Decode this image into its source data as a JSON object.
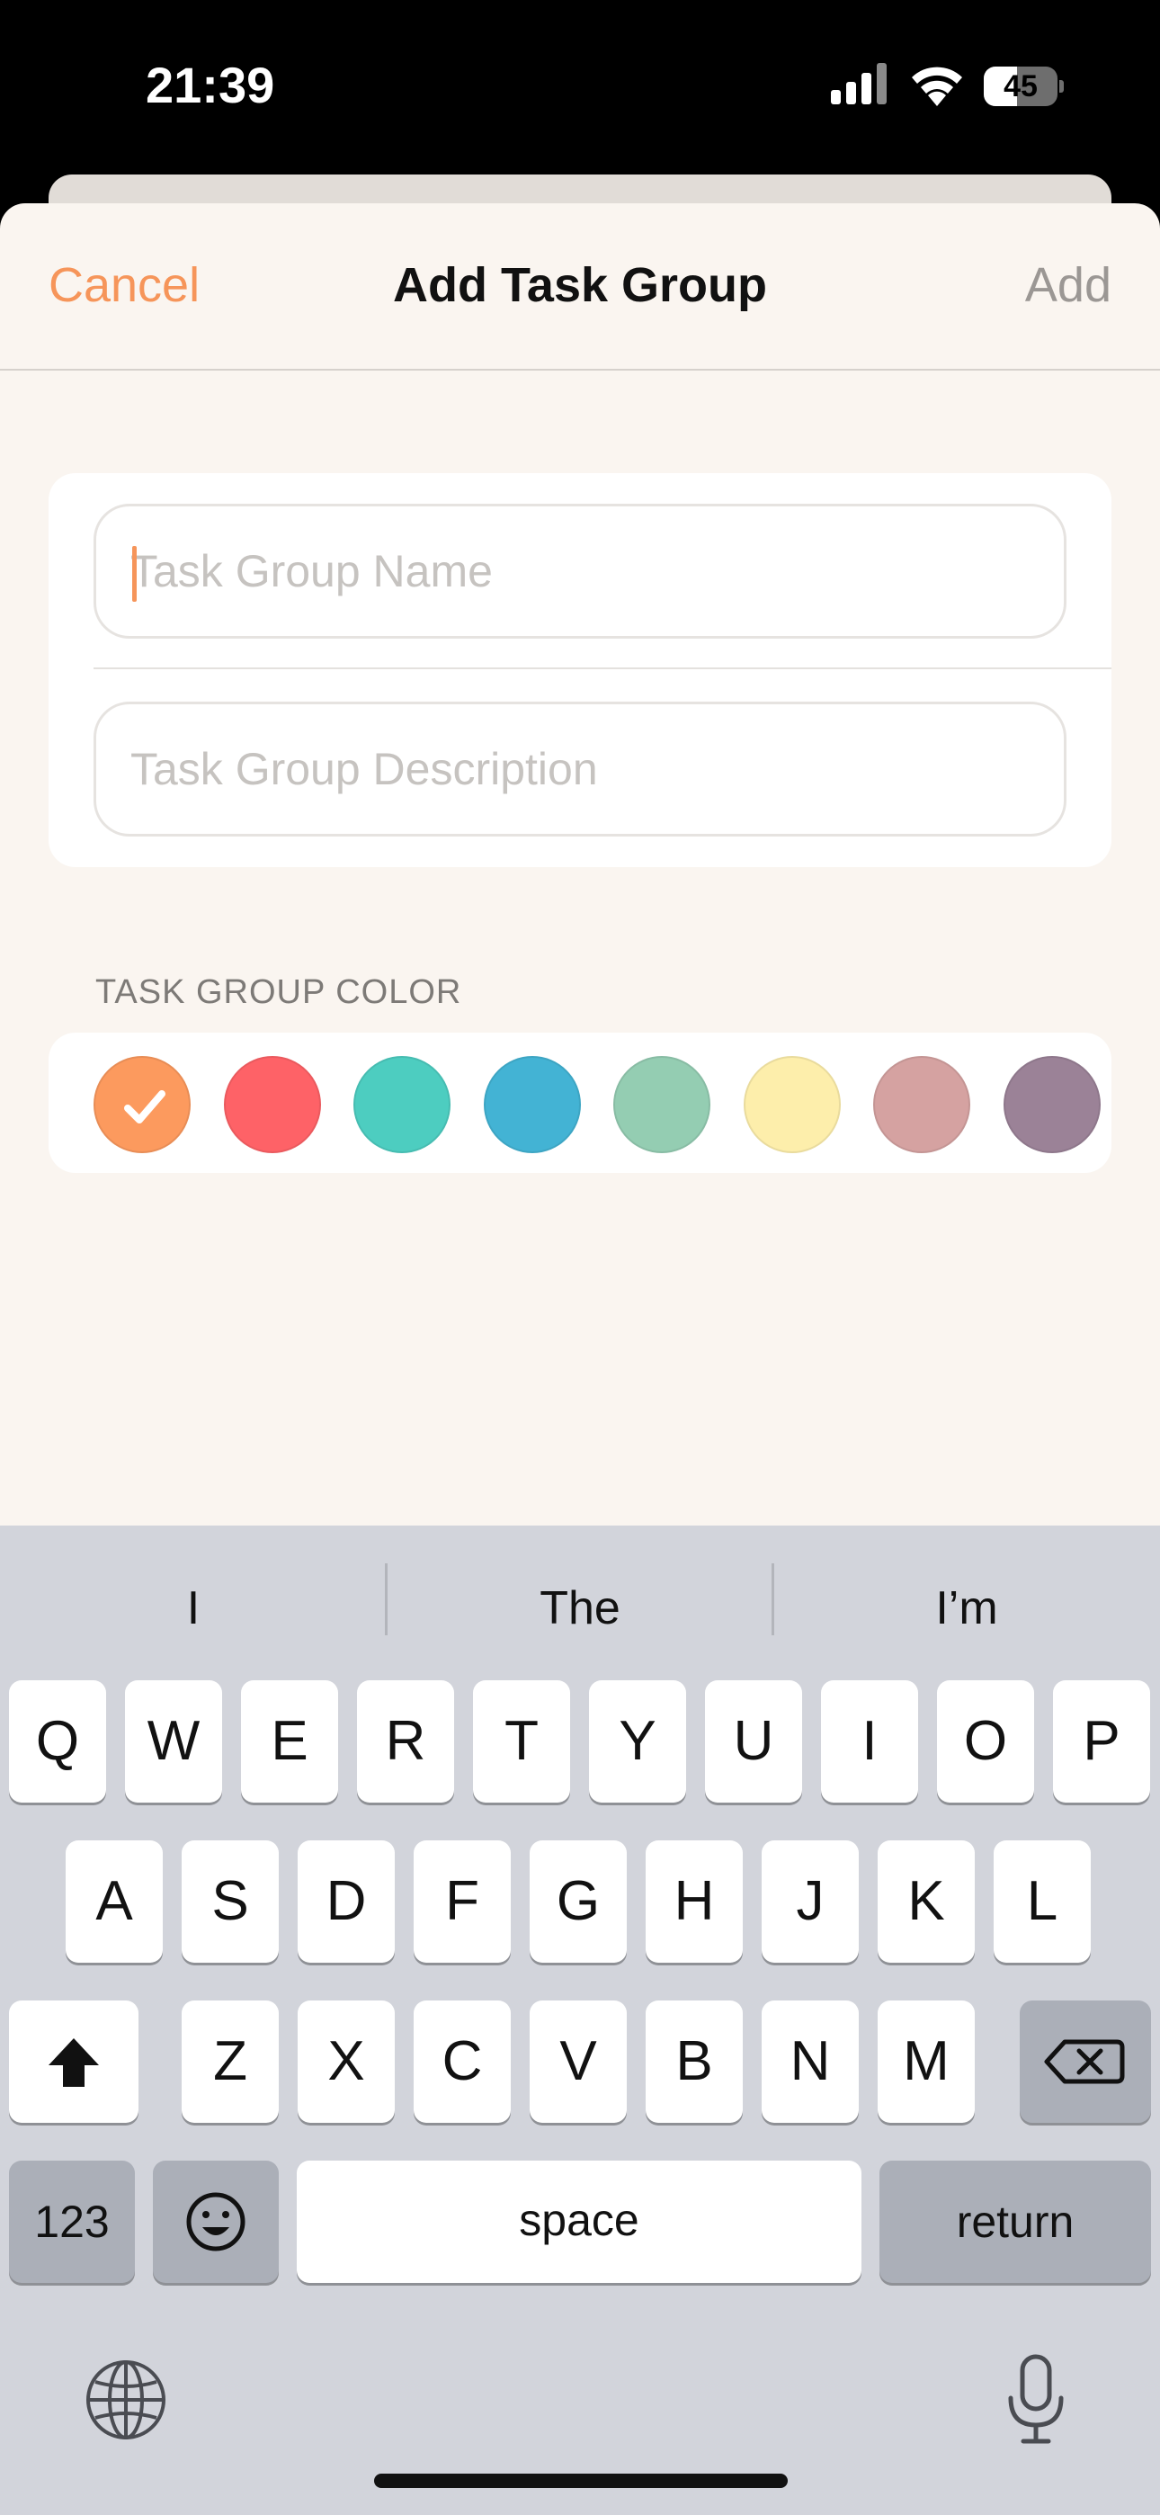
{
  "status_bar": {
    "time": "21:39",
    "battery_level": "45",
    "battery_fraction": 0.45,
    "icons": [
      "cellular-signal-icon",
      "wifi-icon",
      "battery-icon"
    ]
  },
  "nav": {
    "cancel_label": "Cancel",
    "title": "Add Task Group",
    "add_label": "Add"
  },
  "form": {
    "name_placeholder": "Task Group Name",
    "name_value": "",
    "description_placeholder": "Task Group Description",
    "description_value": ""
  },
  "color_section": {
    "label": "TASK GROUP COLOR",
    "selected_index": 0,
    "swatches": [
      "#fc9a5e",
      "#fe6267",
      "#4dcdc0",
      "#43b3d4",
      "#94cdb2",
      "#fdeeab",
      "#d5a2a1",
      "#9b8297"
    ]
  },
  "keyboard": {
    "suggestions": [
      "I",
      "The",
      "I’m"
    ],
    "row1": [
      "Q",
      "W",
      "E",
      "R",
      "T",
      "Y",
      "U",
      "I",
      "O",
      "P"
    ],
    "row2": [
      "A",
      "S",
      "D",
      "F",
      "G",
      "H",
      "J",
      "K",
      "L"
    ],
    "row3": [
      "Z",
      "X",
      "C",
      "V",
      "B",
      "N",
      "M"
    ],
    "numbers_label": "123",
    "space_label": "space",
    "return_label": "return",
    "icons": [
      "shift-icon",
      "backspace-icon",
      "emoji-icon",
      "globe-icon",
      "microphone-icon"
    ]
  },
  "colors": {
    "accent": "#f6955a",
    "sheet_background": "#faf5f0",
    "keyboard_background": "#d2d4db"
  }
}
